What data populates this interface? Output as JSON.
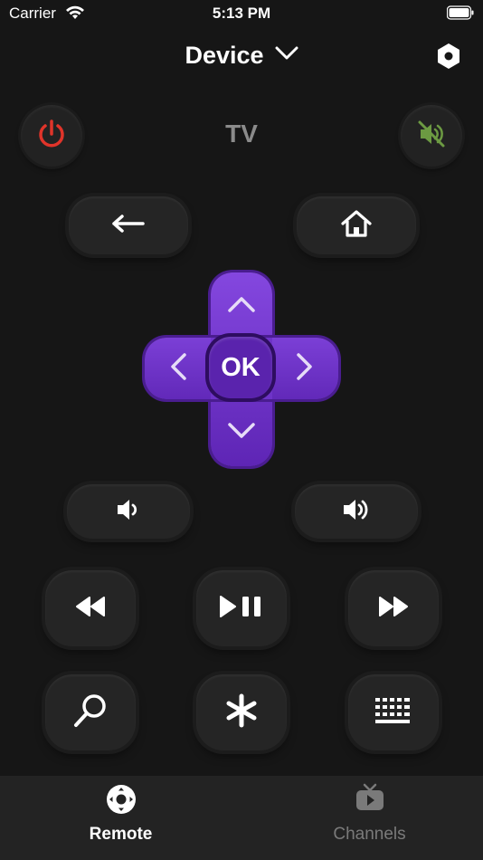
{
  "status_bar": {
    "carrier": "Carrier",
    "time": "5:13 PM"
  },
  "header": {
    "device_label": "Device"
  },
  "top_row": {
    "tv_label": "TV"
  },
  "dpad": {
    "ok_label": "OK"
  },
  "tabs": [
    {
      "label": "Remote",
      "active": true
    },
    {
      "label": "Channels",
      "active": false
    }
  ],
  "colors": {
    "background": "#161616",
    "power": "#e0342a",
    "mute": "#6c9a42",
    "dpad": "#7a3ed9",
    "active_tab": "#ffffff",
    "inactive_tab": "#7a7a7a"
  },
  "icons": [
    "wifi-icon",
    "battery-icon",
    "chevron-down-icon",
    "settings-hex-icon",
    "power-icon",
    "mute-icon",
    "back-arrow-icon",
    "home-icon",
    "volume-down-icon",
    "volume-up-icon",
    "rewind-icon",
    "play-pause-icon",
    "fast-forward-icon",
    "search-icon",
    "asterisk-icon",
    "keyboard-icon",
    "remote-icon",
    "tv-icon"
  ]
}
